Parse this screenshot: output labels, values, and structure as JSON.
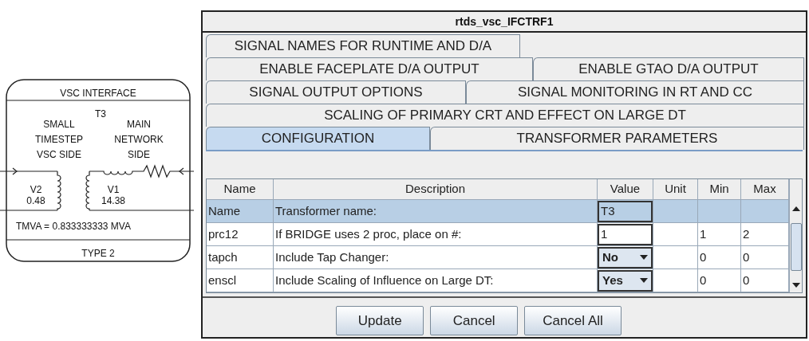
{
  "component": {
    "title": "VSC INTERFACE",
    "name": "T3",
    "left_side": [
      "SMALL",
      "TIMESTEP",
      "VSC SIDE"
    ],
    "right_side": [
      "MAIN",
      "NETWORK",
      "SIDE"
    ],
    "v2_label": "V2",
    "v2_value": "0.48",
    "v1_label": "V1",
    "v1_value": "14.38",
    "rating": "TMVA = 0.833333333 MVA",
    "type": "TYPE 2"
  },
  "dialog": {
    "title": "rtds_vsc_IFCTRF1",
    "tab_rows": [
      [
        {
          "label": "SIGNAL NAMES FOR RUNTIME AND D/A",
          "selected": false
        }
      ],
      [
        {
          "label": "ENABLE FACEPLATE D/A OUTPUT",
          "selected": false
        },
        {
          "label": "ENABLE GTAO D/A OUTPUT",
          "selected": false
        }
      ],
      [
        {
          "label": "SIGNAL OUTPUT OPTIONS",
          "selected": false
        },
        {
          "label": "SIGNAL MONITORING IN RT AND CC",
          "selected": false
        }
      ],
      [
        {
          "label": "SCALING OF PRIMARY CRT AND EFFECT ON LARGE DT",
          "selected": false
        }
      ],
      [
        {
          "label": "CONFIGURATION",
          "selected": true
        },
        {
          "label": "TRANSFORMER PARAMETERS",
          "selected": false
        }
      ]
    ],
    "table": {
      "columns": [
        "Name",
        "Description",
        "Value",
        "Unit",
        "Min",
        "Max"
      ],
      "rows": [
        {
          "name": "Name",
          "description": "Transformer name:",
          "value": "T3",
          "kind": "text",
          "min": "",
          "max": "",
          "selected": true
        },
        {
          "name": "prc12",
          "description": "If BRIDGE uses 2 proc, place on #:",
          "value": "1",
          "kind": "text",
          "min": "1",
          "max": "2",
          "selected": false
        },
        {
          "name": "tapch",
          "description": "Include Tap Changer:",
          "value": "No",
          "kind": "dropdown",
          "min": "0",
          "max": "0",
          "selected": false
        },
        {
          "name": "enscl",
          "description": "Include Scaling of Influence on Large DT:",
          "value": "Yes",
          "kind": "dropdown",
          "min": "0",
          "max": "0",
          "selected": false
        }
      ]
    },
    "buttons": [
      "Update",
      "Cancel",
      "Cancel All"
    ]
  }
}
